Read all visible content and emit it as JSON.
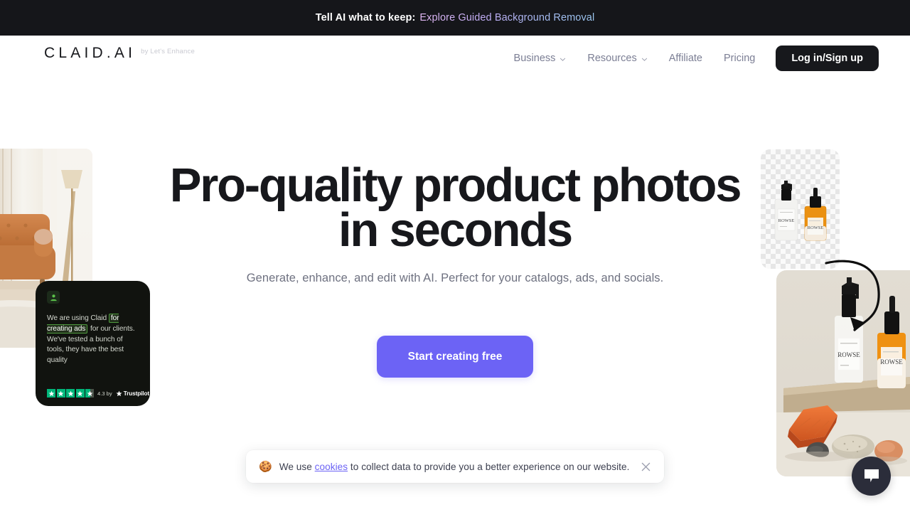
{
  "announcement": {
    "lead": "Tell AI what to keep:",
    "link": "Explore Guided Background Removal"
  },
  "header": {
    "logo": "CLAID.AI",
    "logo_sub": "by Let's Enhance",
    "nav": [
      {
        "label": "Business",
        "has_chevron": true
      },
      {
        "label": "Resources",
        "has_chevron": true
      },
      {
        "label": "Affiliate",
        "has_chevron": false
      },
      {
        "label": "Pricing",
        "has_chevron": false
      }
    ],
    "login_label": "Log in/Sign up"
  },
  "hero": {
    "headline_line1": "Pro-quality product photos",
    "headline_line2": "in seconds",
    "subheadline": "Generate, enhance, and edit with AI. Perfect for your catalogs, ads, and socials.",
    "cta_label": "Start creating free"
  },
  "testimonial": {
    "text_before": "We are using Claid ",
    "highlight": "for creating ads",
    "text_after": " for our clients. We've tested a bunch of tools, they have the best quality",
    "rating_value": "4.3 by",
    "platform": "Trustpilot",
    "stars_total": 5,
    "stars_filled": 4
  },
  "cookie_banner": {
    "emoji": "🍪",
    "text_before": "We use ",
    "link": "cookies",
    "text_after": " to collect data to provide you a better experience on our website."
  },
  "colors": {
    "accent": "#6c63f5",
    "dark": "#17181c",
    "announce_bg": "#15161a",
    "nav_text": "#7b7e94",
    "trustpilot_green": "#00b67a"
  }
}
